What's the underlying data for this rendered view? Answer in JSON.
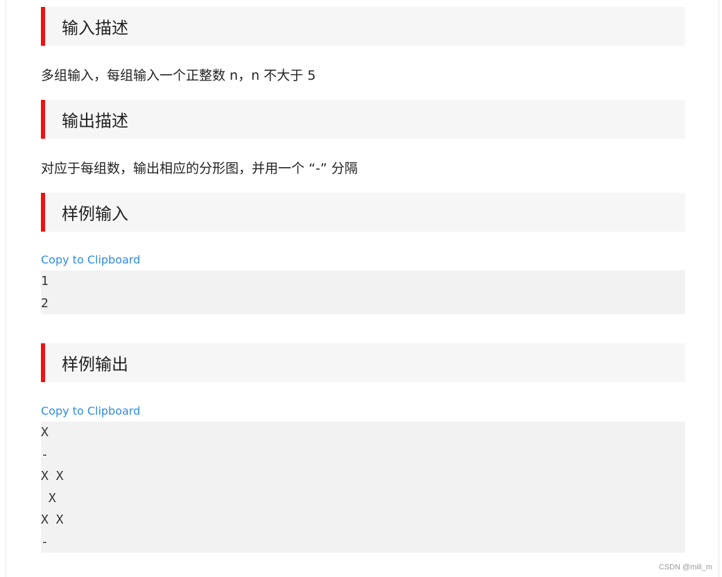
{
  "sections": {
    "input_desc": {
      "title": "输入描述",
      "text": "多组输入，每组输入一个正整数 n，n 不大于 5"
    },
    "output_desc": {
      "title": "输出描述",
      "text": "对应于每组数，输出相应的分形图，并用一个 “-” 分隔"
    },
    "sample_input": {
      "title": "样例输入",
      "copy_label": "Copy to Clipboard",
      "lines": [
        "1",
        "2"
      ]
    },
    "sample_output": {
      "title": "样例输出",
      "copy_label": "Copy to Clipboard",
      "lines": [
        "X",
        "-",
        "X X",
        " X",
        "X X",
        "-"
      ]
    }
  },
  "watermark": "CSDN @mili_m"
}
